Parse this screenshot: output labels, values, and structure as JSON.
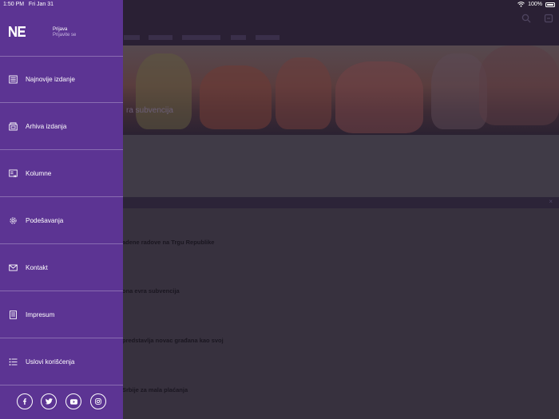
{
  "status_bar": {
    "time": "1:50 PM",
    "date": "Fri Jan 31",
    "battery": "100%",
    "battery_level": 1.0
  },
  "drawer": {
    "logo": "NE",
    "login_title": "Prijava",
    "login_subtitle": "Prijavite se",
    "menu": [
      {
        "label": "Najnovije izdanje",
        "icon": "newspaper-icon"
      },
      {
        "label": "Arhiva izdanja",
        "icon": "archive-icon"
      },
      {
        "label": "Kolumne",
        "icon": "columns-icon"
      },
      {
        "label": "Podešavanja",
        "icon": "settings-icon"
      },
      {
        "label": "Kontakt",
        "icon": "mail-icon"
      },
      {
        "label": "Impresum",
        "icon": "document-icon"
      },
      {
        "label": "Uslovi korišćenja",
        "icon": "list-icon"
      }
    ],
    "social": [
      "facebook-icon",
      "twitter-icon",
      "youtube-icon",
      "instagram-icon"
    ]
  },
  "background": {
    "hero_title": "ra subvencija",
    "articles": [
      "adene radove na Trgu Republike",
      "ona evra subvencija",
      "predstavlja novac građana kao svoj",
      "Srbije za mala plaćanja"
    ]
  },
  "colors": {
    "drawer": "#5c3493",
    "overlay": "#2a2034"
  }
}
